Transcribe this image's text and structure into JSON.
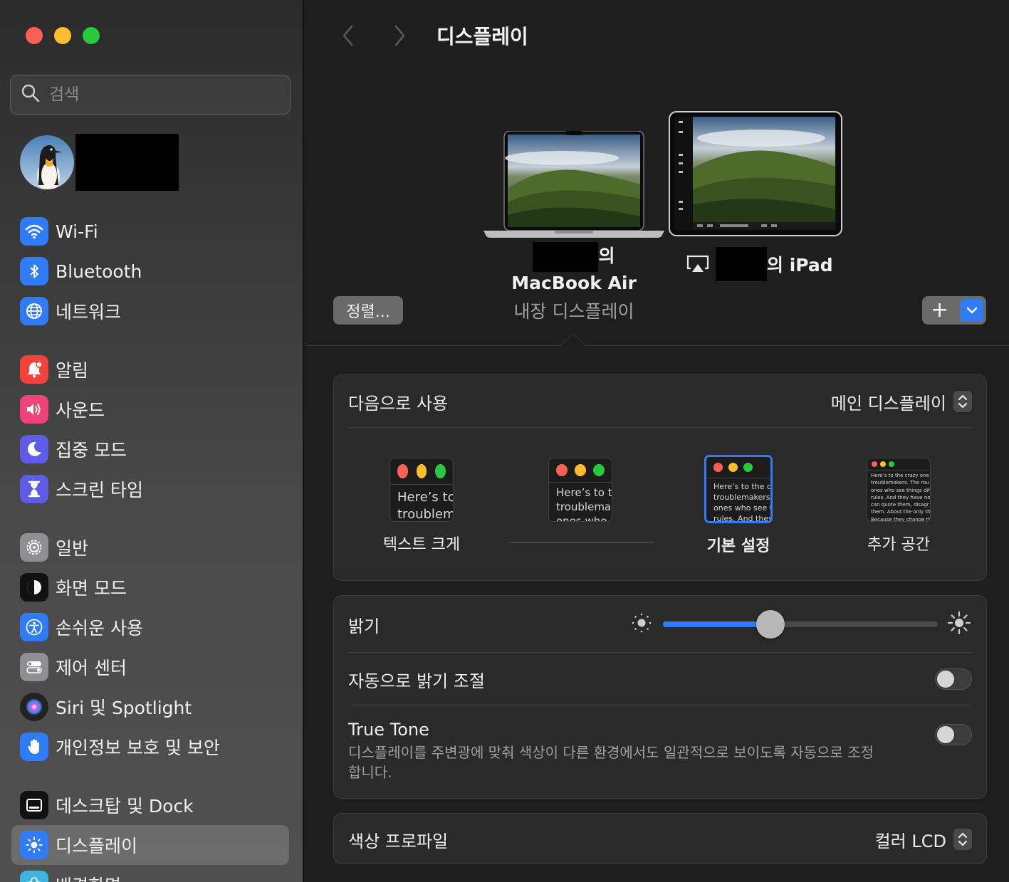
{
  "window": {
    "title": "디스플레이"
  },
  "sidebar": {
    "search_placeholder": "검색",
    "items": [
      {
        "label": "Wi-Fi",
        "icon": "wifi-icon",
        "color": "#2f7cf6"
      },
      {
        "label": "Bluetooth",
        "icon": "bluetooth-icon",
        "color": "#2f7cf6"
      },
      {
        "label": "네트워크",
        "icon": "globe-icon",
        "color": "#2f7cf6"
      },
      {
        "label": "알림",
        "icon": "bell-icon",
        "color": "#f0433a"
      },
      {
        "label": "사운드",
        "icon": "speaker-icon",
        "color": "#f0437a"
      },
      {
        "label": "집중 모드",
        "icon": "moon-icon",
        "color": "#5e5ce6"
      },
      {
        "label": "스크린 타임",
        "icon": "hourglass-icon",
        "color": "#5e5ce6"
      },
      {
        "label": "일반",
        "icon": "gear-icon",
        "color": "#8e8e93"
      },
      {
        "label": "화면 모드",
        "icon": "appearance-icon",
        "color": "#111111"
      },
      {
        "label": "손쉬운 사용",
        "icon": "accessibility-icon",
        "color": "#2f7cf6"
      },
      {
        "label": "제어 센터",
        "icon": "switches-icon",
        "color": "#8e8e93"
      },
      {
        "label": "Siri 및 Spotlight",
        "icon": "siri-icon",
        "color": "#222222"
      },
      {
        "label": "개인정보 보호 및 보안",
        "icon": "hand-icon",
        "color": "#2f7cf6"
      },
      {
        "label": "데스크탑 및 Dock",
        "icon": "dock-icon",
        "color": "#111111"
      },
      {
        "label": "디스플레이",
        "icon": "sun-icon",
        "color": "#2f7cf6"
      },
      {
        "label": "배경화면",
        "icon": "flower-icon",
        "color": "#3fb4e0"
      }
    ]
  },
  "arrangement": {
    "arrange_button": "정렬...",
    "macbook": {
      "owner_suffix": "의",
      "model": "MacBook Air",
      "subtitle": "내장 디스플레이"
    },
    "ipad": {
      "suffix": "의 iPad"
    },
    "add_button": "+"
  },
  "use_as": {
    "label": "다음으로 사용",
    "value": "메인 디스플레이"
  },
  "resolution": {
    "options": [
      {
        "label": "텍스트 크게",
        "sample": "Here’s tc\ntroublem"
      },
      {
        "label": "",
        "sample": "Here’s to t\ntroublema\nones who"
      },
      {
        "label": "기본 설정",
        "sample": "Here’s to the cr\ntroublemakers.\nones who see t\nrules. And they"
      },
      {
        "label": "추가 공간",
        "sample": "Here’s to the crazy one\ntroublemakers. The rou\nones who see things dif\nrules. And they have no\ncan quote them, disagr\nthem. About the only th\nBecause they change th"
      }
    ],
    "selected_index": 2
  },
  "brightness": {
    "label": "밝기",
    "level": 0.39
  },
  "auto_brightness": {
    "label": "자동으로 밝기 조절",
    "enabled": false
  },
  "true_tone": {
    "label": "True Tone",
    "description": "디스플레이를 주변광에 맞춰 색상이 다른 환경에서도 일관적으로 보이도록 자동으로 조정합니다.",
    "enabled": false
  },
  "color_profile": {
    "label": "색상 프로파일",
    "value": "컬러 LCD"
  },
  "colors": {
    "accent": "#2f7cf6",
    "window_bg": "#1e1e1e",
    "card_bg": "#2a2a2a"
  }
}
